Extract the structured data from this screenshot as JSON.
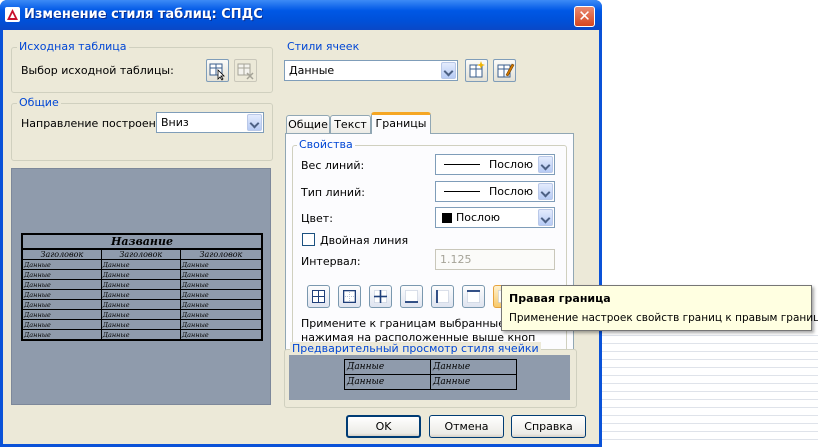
{
  "window": {
    "title": "Изменение стиля таблиц: СПДС",
    "close_label": "✕"
  },
  "source_table": {
    "group_label": "Исходная таблица",
    "select_label": "Выбор исходной таблицы:"
  },
  "general": {
    "group_label": "Общие",
    "direction_label": "Направление построения:",
    "direction_value": "Вниз"
  },
  "cell_styles": {
    "group_label": "Стили ячеек",
    "selected": "Данные"
  },
  "tabs": [
    {
      "label": "Общие"
    },
    {
      "label": "Текст"
    },
    {
      "label": "Границы"
    }
  ],
  "properties": {
    "group_label": "Свойства",
    "line_weight_label": "Вес линий:",
    "line_weight_value": "Послою",
    "line_type_label": "Тип линий:",
    "line_type_value": "Послою",
    "color_label": "Цвет:",
    "color_value": "Послою",
    "double_line_label": "Двойная линия",
    "interval_label": "Интервал:",
    "interval_value": "1.125",
    "hint_line1": "Примените к границам выбранные свой",
    "hint_line2": "нажимая на расположенные выше кноп"
  },
  "preview": {
    "title": "Название",
    "headers": [
      "Заголовок",
      "Заголовок",
      "Заголовок"
    ],
    "cell": "Данные"
  },
  "cell_preview": {
    "group_label": "Предварительный просмотр стиля ячейки",
    "cell": "Данные"
  },
  "tooltip": {
    "title": "Правая граница",
    "body": "Применение настроек свойств границ к правым границам."
  },
  "buttons": {
    "ok": "OK",
    "cancel": "Отмена",
    "help": "Справка"
  },
  "colors": {
    "title_bar": "#0058e6",
    "dialog_bg": "#ece9d8",
    "group_label": "#0046d5",
    "preview_bg": "#8f9bac",
    "tab_highlight": "#f5a623",
    "tooltip_bg": "#ffffe1"
  }
}
